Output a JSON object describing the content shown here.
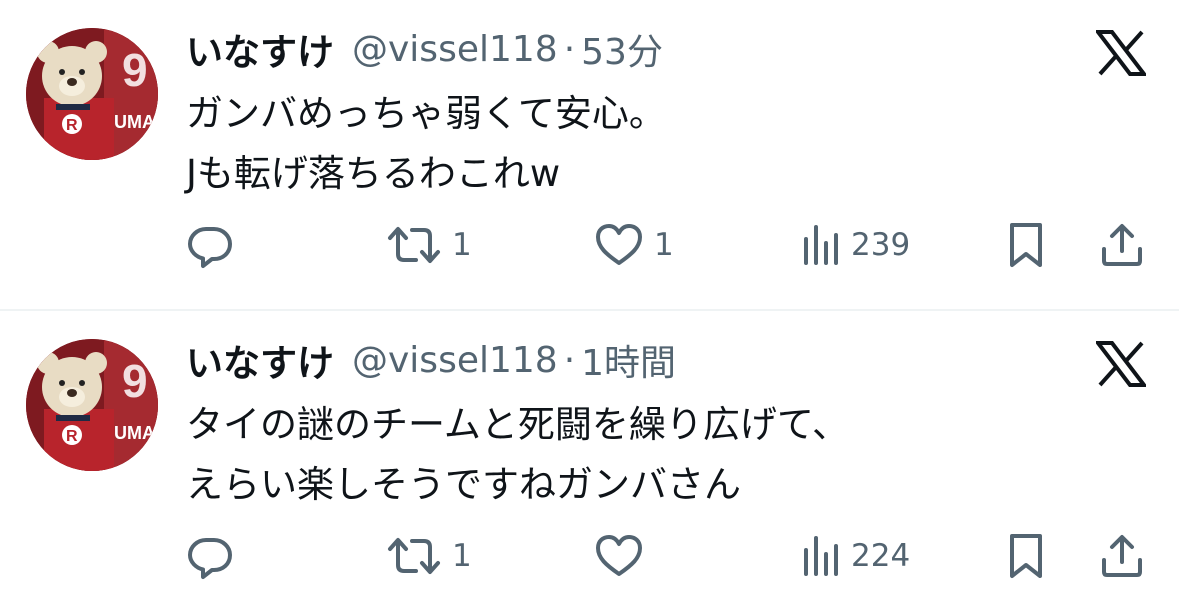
{
  "colors": {
    "text": "#0f1419",
    "muted": "#536471",
    "divider": "#eff3f4"
  },
  "tweets": [
    {
      "name": "いなすけ",
      "handle": "@vissel118",
      "separator": "·",
      "time": "53分",
      "lines": [
        "ガンバめっちゃ弱くて安心。",
        "Jも転げ落ちるわこれw"
      ],
      "replies": "",
      "retweets": "1",
      "likes": "1",
      "views": "239",
      "icons": [
        "x-logo-icon",
        "reply-icon",
        "retweet-icon",
        "like-icon",
        "views-icon",
        "bookmark-icon",
        "share-icon"
      ]
    },
    {
      "name": "いなすけ",
      "handle": "@vissel118",
      "separator": "·",
      "time": "1時間",
      "lines": [
        "タイの謎のチームと死闘を繰り広げて、",
        "えらい楽しそうですねガンバさん"
      ],
      "replies": "",
      "retweets": "1",
      "likes": "",
      "views": "224",
      "icons": [
        "x-logo-icon",
        "reply-icon",
        "retweet-icon",
        "like-icon",
        "views-icon",
        "bookmark-icon",
        "share-icon"
      ]
    }
  ]
}
